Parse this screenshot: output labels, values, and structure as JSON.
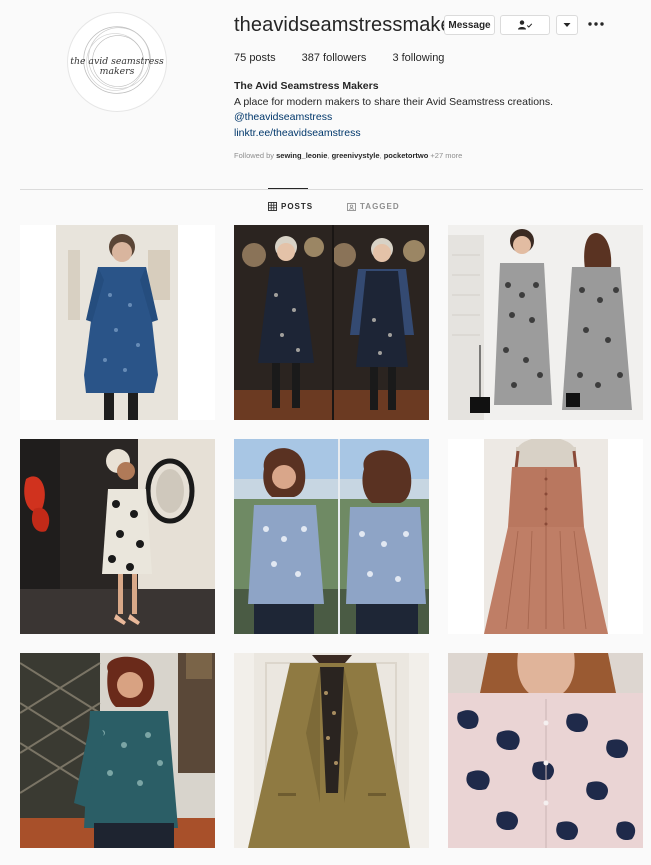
{
  "profile": {
    "username": "theavidseamstressmakers",
    "avatar_text_line1": "the avid seamstress",
    "avatar_text_line2": "makers",
    "message_label": "Message",
    "follow_icon": "person-check-icon",
    "dropdown_icon": "caret-down-icon",
    "more_icon": "more-dots-icon"
  },
  "stats": {
    "posts_count": "75",
    "posts_label": "posts",
    "followers_count": "387",
    "followers_label": "followers",
    "following_count": "3",
    "following_label": "following"
  },
  "bio": {
    "full_name": "The Avid Seamstress Makers",
    "description": "A place for modern makers to share their Avid Seamstress creations.",
    "mention": "@theavidseamstress",
    "link": "linktr.ee/theavidseamstress"
  },
  "followed_by": {
    "prefix": "Followed by",
    "users": [
      "sewing_leonie",
      "greenivystyle",
      "pocketortwo"
    ],
    "more": "+27 more"
  },
  "tabs": [
    {
      "label": "POSTS",
      "icon": "grid-icon",
      "active": true
    },
    {
      "label": "TAGGED",
      "icon": "tagged-icon",
      "active": false
    }
  ],
  "colors": {
    "link": "#00376b",
    "border": "#dbdbdb",
    "muted": "#8e8e8e",
    "text": "#262626",
    "background": "#fafafa"
  }
}
